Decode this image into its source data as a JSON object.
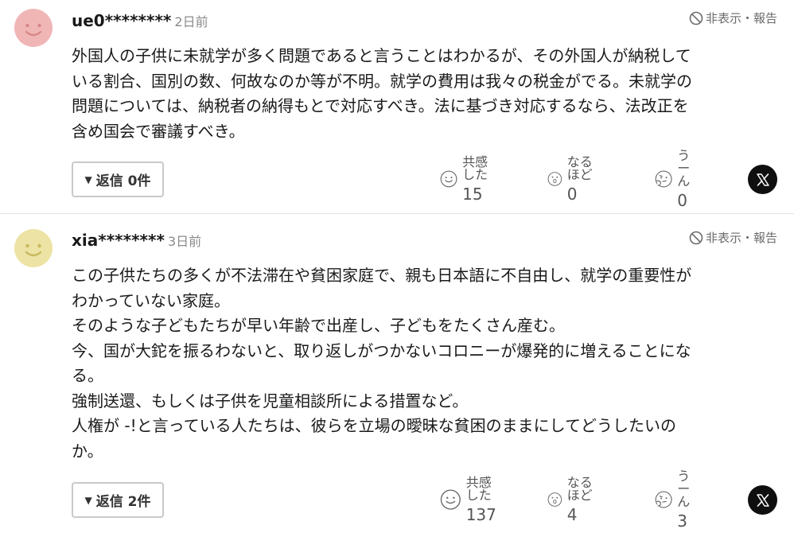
{
  "comments": [
    {
      "username": "ue0********",
      "time": "2日前",
      "avatar_color": "#f0b6b6",
      "avatar_face_color": "#d98787",
      "hide_report": "非表示・報告",
      "lines": [
        "外国人の子供に未就学が多く問題であると言うことはわかるが、その外国人が納税して",
        "いる割合、国別の数、何故なのか等が不明。就学の費用は我々の税金がでる。未就学の",
        "問題については、納税者の納得もとで対応すべき。法に基づき対応するなら、法改正を",
        "含め国会で審議すべき。"
      ],
      "reply_label": "返信 0件",
      "reactions": [
        {
          "label": "共感した",
          "count": "15",
          "icon": "smile-icon"
        },
        {
          "label": "なるほど",
          "count": "0",
          "icon": "surprised-icon"
        },
        {
          "label": "うーん",
          "count": "0",
          "icon": "thinking-icon"
        }
      ]
    },
    {
      "username": "xia********",
      "time": "3日前",
      "avatar_color": "#ece3a4",
      "avatar_face_color": "#c9b95e",
      "hide_report": "非表示・報告",
      "lines": [
        "この子供たちの多くが不法滞在や貧困家庭で、親も日本語に不自由し、就学の重要性が",
        "わかっていない家庭。",
        "そのような子どもたちが早い年齢で出産し、子どもをたくさん産む。",
        "今、国が大鉈を振るわないと、取り返しがつかないコロニーが爆発的に増えることにな",
        "る。",
        "強制送還、もしくは子供を児童相談所による措置など。",
        "人権が -!と言っている人たちは、彼らを立場の曖昧な貧困のままにしてどうしたいの",
        "か。"
      ],
      "reply_label": "返信 2件",
      "reactions": [
        {
          "label": "共感した",
          "count": "137",
          "icon": "smile-icon"
        },
        {
          "label": "なるほど",
          "count": "4",
          "icon": "surprised-icon"
        },
        {
          "label": "うーん",
          "count": "3",
          "icon": "thinking-icon"
        }
      ]
    }
  ],
  "share_icon": "x-logo-icon",
  "reply_toggle_icon": "triangle-down-icon"
}
